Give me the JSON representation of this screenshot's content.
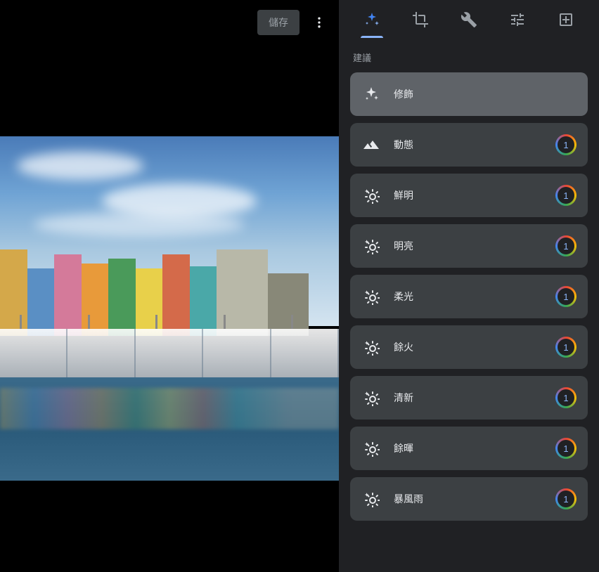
{
  "topbar": {
    "save_label": "儲存"
  },
  "panel": {
    "section_label": "建議",
    "suggestions": [
      {
        "label": "修飾",
        "icon": "sparkle",
        "badge": false,
        "selected": true
      },
      {
        "label": "動態",
        "icon": "mountain",
        "badge": true,
        "selected": false
      },
      {
        "label": "鮮明",
        "icon": "sun",
        "badge": true,
        "selected": false
      },
      {
        "label": "明亮",
        "icon": "sun",
        "badge": true,
        "selected": false
      },
      {
        "label": "柔光",
        "icon": "sun",
        "badge": true,
        "selected": false
      },
      {
        "label": "餘火",
        "icon": "sun",
        "badge": true,
        "selected": false
      },
      {
        "label": "清新",
        "icon": "sun",
        "badge": true,
        "selected": false
      },
      {
        "label": "餘暉",
        "icon": "sun",
        "badge": true,
        "selected": false
      },
      {
        "label": "暴風雨",
        "icon": "sun",
        "badge": true,
        "selected": false
      }
    ],
    "badge_text": "1"
  },
  "tabs": {
    "active": 0,
    "items": [
      "suggestions",
      "crop",
      "tools",
      "adjust",
      "markup"
    ]
  }
}
